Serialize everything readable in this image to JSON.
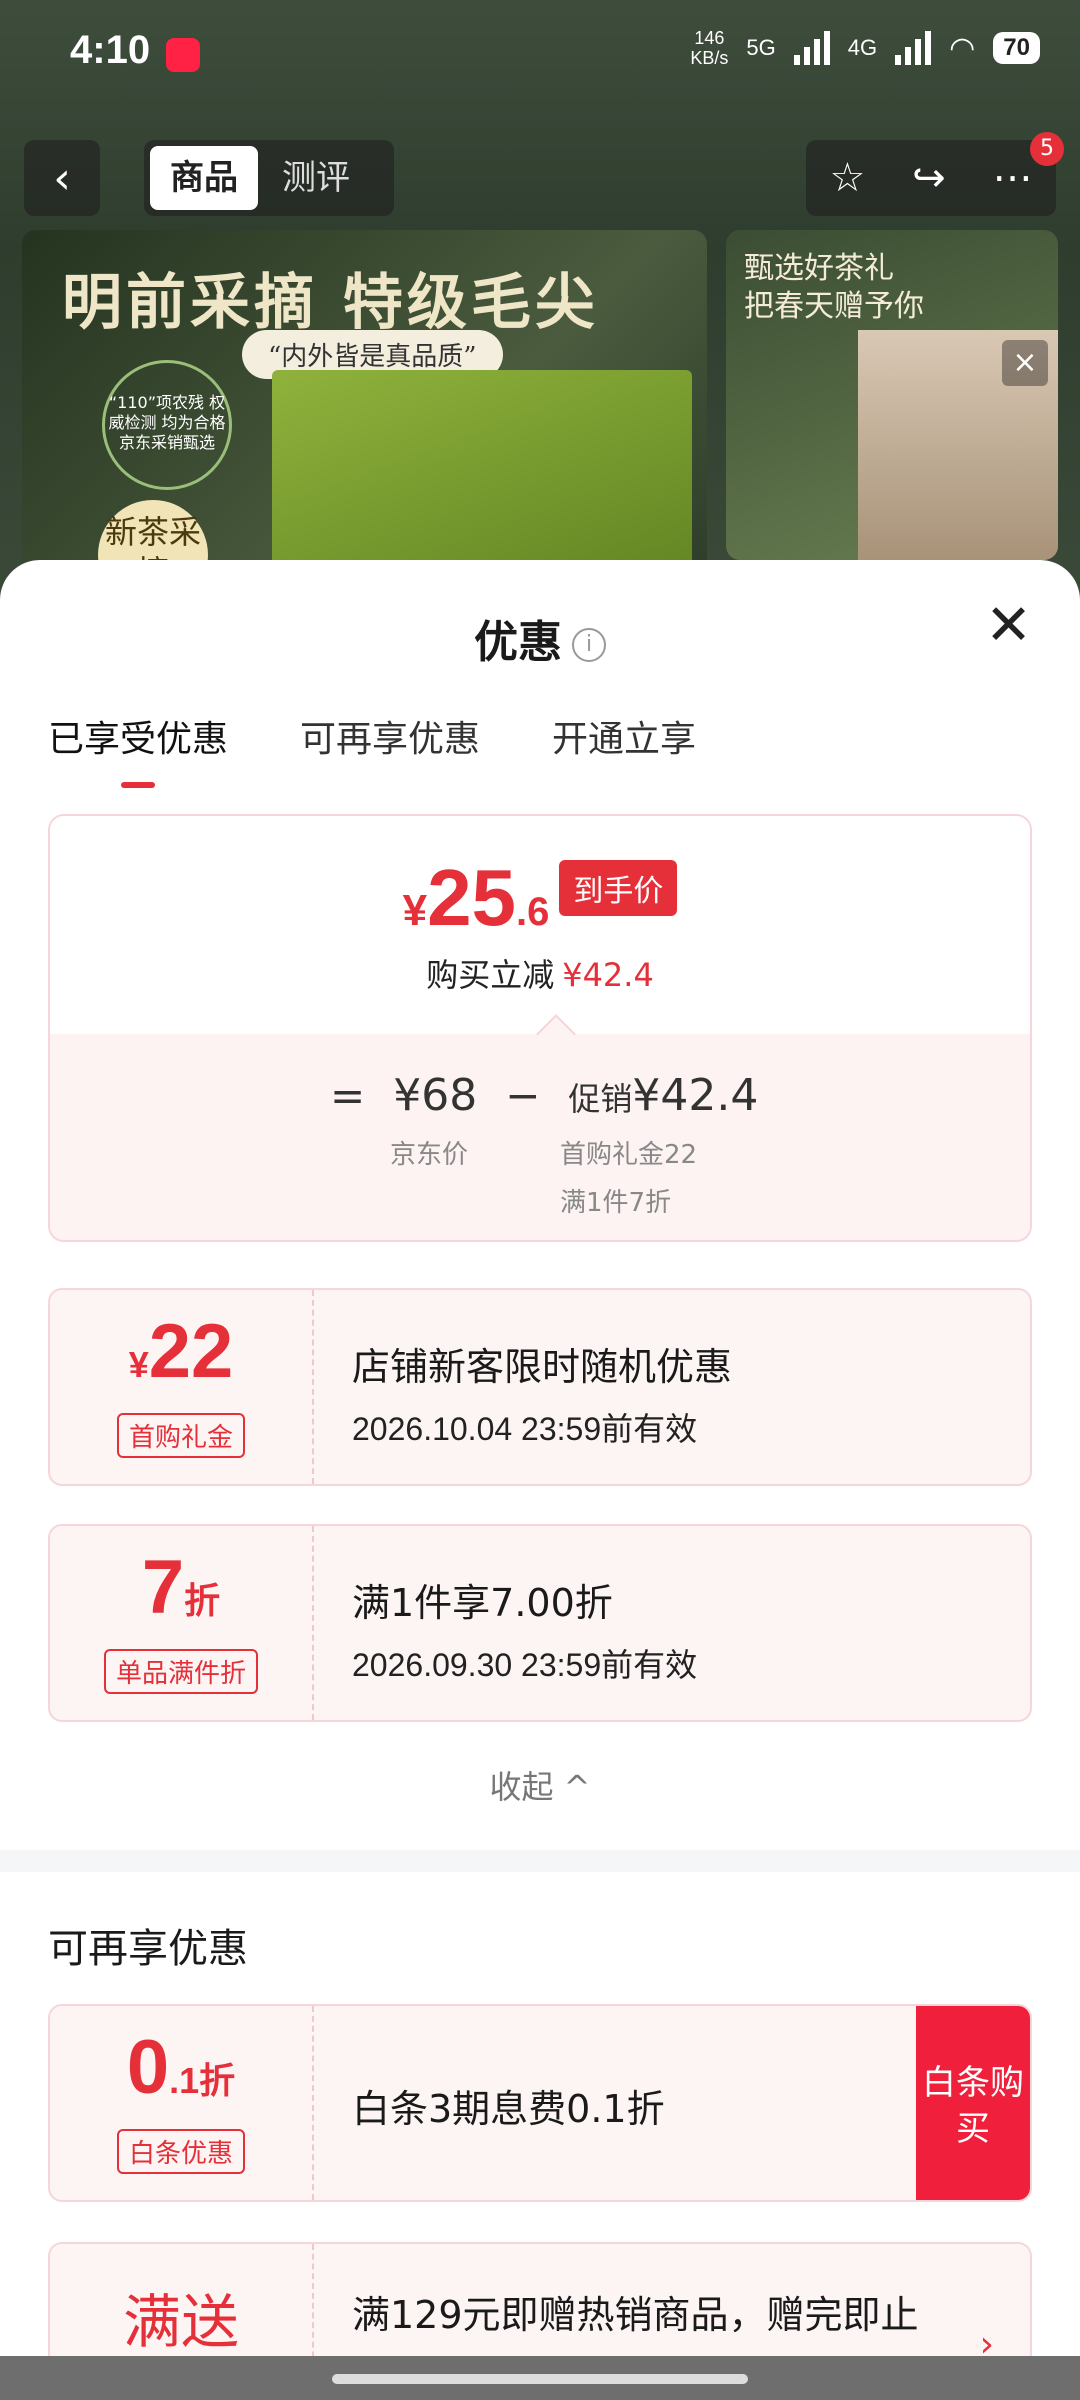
{
  "status_bar": {
    "time": "4:10",
    "speed_value": "146",
    "speed_unit": "KB/s",
    "net1": "5G",
    "net2": "4G",
    "battery": "70"
  },
  "topnav": {
    "tabs": [
      "商品",
      "测评"
    ],
    "active_tab": "商品",
    "badge_count": "5"
  },
  "banner": {
    "headline": "明前采摘 特级毛尖",
    "subline": "“内外皆是真品质”",
    "seal_text": "“110”项农残 权威检测 均为合格 京东采销甄选",
    "new_tea": "新茶采摘",
    "side_text_1": "甄选好茶礼",
    "side_text_2": "把春天赠予你"
  },
  "sheet": {
    "title": "优惠",
    "tabs": [
      "已享受优惠",
      "可再享优惠",
      "开通立享"
    ],
    "active_tab": "已享受优惠"
  },
  "price": {
    "currency": "¥",
    "integer": "25",
    "decimal": ".6",
    "tag": "到手价",
    "saving_label": "购买立减",
    "saving_amount": "¥42.4",
    "eq": "=",
    "base_price": "¥68",
    "minus": "−",
    "promo_label": "促销",
    "promo_amount": "¥42.4",
    "base_label": "京东价",
    "promo_detail_1": "首购礼金22",
    "promo_detail_2": "满1件7折"
  },
  "coupons_enjoyed": [
    {
      "value_main": "22",
      "value_prefix": "¥",
      "value_suffix": "",
      "pill": "首购礼金",
      "title": "店铺新客限时随机优惠",
      "date": "2026.10.04 23:59前有效"
    },
    {
      "value_main": "7",
      "value_prefix": "",
      "value_suffix": "折",
      "pill": "单品满件折",
      "title": "满1件享7.00折",
      "date": "2026.09.30 23:59前有效"
    }
  ],
  "collapse_label": "收起 ^",
  "more_section": {
    "title": "可再享优惠",
    "items": [
      {
        "value_main": "0",
        "value_suffix": ".1折",
        "pill": "白条优惠",
        "title": "白条3期息费0.1折",
        "action": "白条购买"
      },
      {
        "value_text": "满送",
        "title": "满129元即赠热销商品，赠完即止"
      }
    ]
  }
}
